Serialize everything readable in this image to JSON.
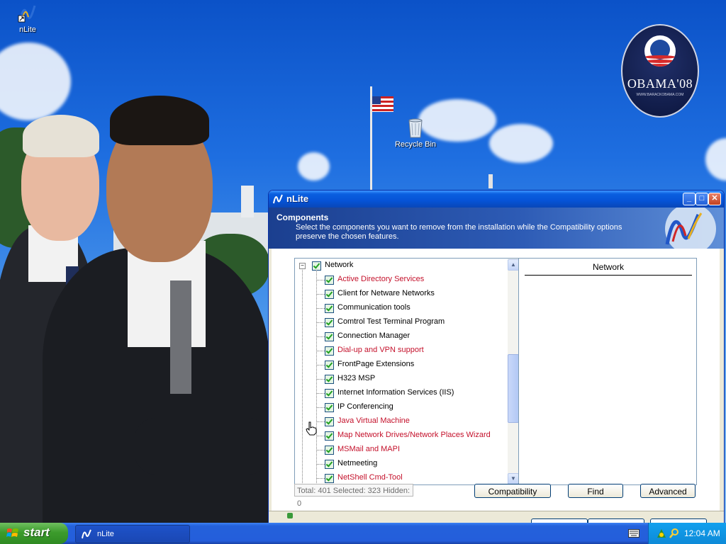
{
  "desktop": {
    "icons": [
      {
        "label": "nLite"
      },
      {
        "label": "Recycle Bin"
      }
    ],
    "wallpaper_badge": {
      "text": "OBAMA'08",
      "subtext": "WWW.BARACKOBAMA.COM"
    }
  },
  "window": {
    "title": "nLite",
    "header": {
      "title": "Components",
      "description": "Select the components you want to remove from the installation while the Compatibility options preserve the chosen features."
    },
    "tree": {
      "root": "Network",
      "items": [
        {
          "label": "Active Directory Services",
          "color": "red"
        },
        {
          "label": "Client for Netware Networks",
          "color": "black"
        },
        {
          "label": "Communication tools",
          "color": "black"
        },
        {
          "label": "Comtrol Test Terminal Program",
          "color": "black"
        },
        {
          "label": "Connection Manager",
          "color": "black"
        },
        {
          "label": "Dial-up and VPN support",
          "color": "red"
        },
        {
          "label": "FrontPage Extensions",
          "color": "black"
        },
        {
          "label": "H323 MSP",
          "color": "black"
        },
        {
          "label": "Internet Information Services (IIS)",
          "color": "black"
        },
        {
          "label": "IP Conferencing",
          "color": "black"
        },
        {
          "label": "Java Virtual Machine",
          "color": "red"
        },
        {
          "label": "Map Network Drives/Network Places Wizard",
          "color": "red"
        },
        {
          "label": "MSMail and MAPI",
          "color": "red"
        },
        {
          "label": "Netmeeting",
          "color": "black"
        },
        {
          "label": "NetShell Cmd-Tool",
          "color": "red"
        }
      ]
    },
    "info_panel": {
      "title": "Network"
    },
    "status": "Total: 401 Selected: 323 Hidden: 0",
    "buttons": {
      "compatibility": "Compatibility",
      "find": "Find",
      "advanced": "Advanced"
    }
  },
  "taskbar": {
    "start_label": "start",
    "task_item": "nLite",
    "clock": "12:04 AM"
  },
  "colors": {
    "titlebar": "#0653d6",
    "header_band": "#2d5bb5",
    "item_red": "#c4112b",
    "taskbar": "#245edb",
    "start_button": "#3c9b2c"
  }
}
